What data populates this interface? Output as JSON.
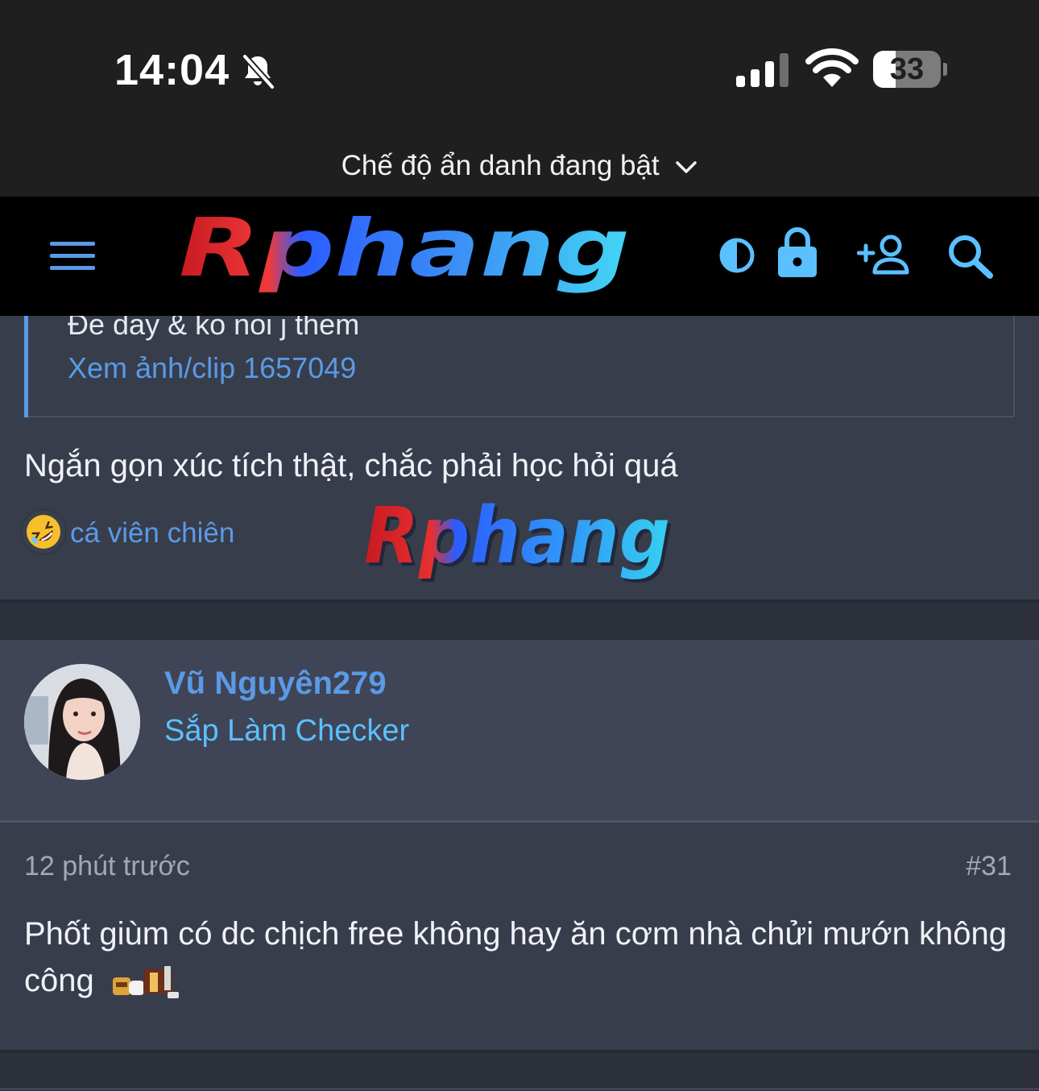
{
  "status_bar": {
    "time": "14:04",
    "battery_level": "33",
    "battery_fraction": 0.33
  },
  "browser": {
    "incognito_label": "Chế độ ẩn danh đang bật"
  },
  "site": {
    "logo_text": "Rphang",
    "header_icons": [
      "menu-icon",
      "contrast-icon",
      "lock-icon",
      "add-user-icon",
      "search-icon"
    ],
    "colors": {
      "link": "#5a9ae6",
      "user_title": "#5bc0ff",
      "header_bg": "#000000",
      "card_bg": "#383d4b"
    }
  },
  "post_30": {
    "quote_line": "Đe day & ko noi j them",
    "quote_link": "Xem ảnh/clip 1657049",
    "text": "Ngắn gọn xúc tích thật, chắc phải học hỏi quá",
    "reaction": {
      "emoji": "rolling-laughing-emoji",
      "user": "cá viên chiên"
    }
  },
  "post_31": {
    "username": "Vũ Nguyên279",
    "user_title": "Sắp Làm Checker",
    "time": "12 phút trước",
    "post_number": "#31",
    "text": "Phốt giùm có dc chịch free không hay ăn cơm nhà chửi mướn không công"
  }
}
